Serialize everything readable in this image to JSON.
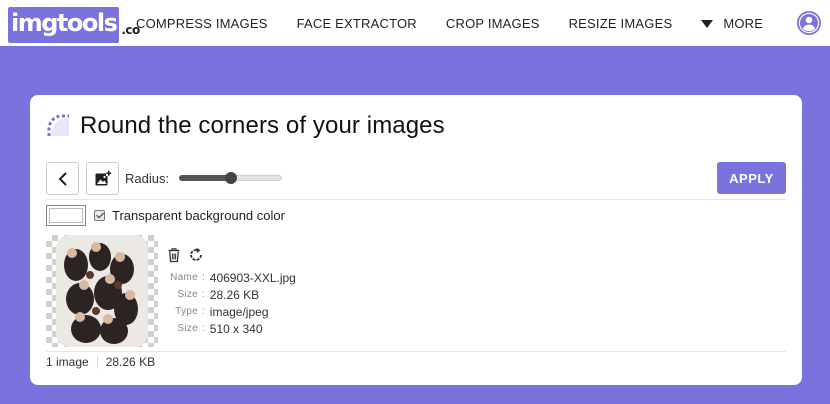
{
  "nav": {
    "logo_main": "imgtools",
    "logo_tld": ".co",
    "items": [
      {
        "label": "COMPRESS IMAGES"
      },
      {
        "label": "FACE EXTRACTOR"
      },
      {
        "label": "CROP IMAGES"
      },
      {
        "label": "RESIZE IMAGES"
      }
    ],
    "more_label": "MORE",
    "user_icon": "user-circle-icon"
  },
  "page": {
    "title": "Round the corners of your images",
    "title_icon": "rounded-corner-icon"
  },
  "toolbar": {
    "back_icon": "chevron-left-icon",
    "add_image_icon": "add-image-icon",
    "radius_label": "Radius:",
    "radius_fraction": 0.5,
    "apply_label": "APPLY"
  },
  "background": {
    "swatch_color": "#ffffff",
    "transparent_checked": true,
    "transparent_label": "Transparent background color"
  },
  "file": {
    "delete_icon": "trash-icon",
    "rotate_icon": "rotate-icon",
    "fields": [
      {
        "key": "Name",
        "value": "406903-XXL.jpg"
      },
      {
        "key": "Size",
        "value": "28.26 KB"
      },
      {
        "key": "Type",
        "value": "image/jpeg"
      },
      {
        "key": "Size",
        "value": "510 x 340"
      }
    ]
  },
  "summary": {
    "count": "1 image",
    "total_size": "28.26 KB"
  },
  "colors": {
    "accent": "#7b73dd",
    "background": "#7b73dd"
  }
}
